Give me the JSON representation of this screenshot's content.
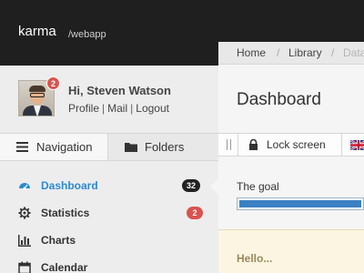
{
  "header": {
    "brand": "karma",
    "brand_sub": "/webapp"
  },
  "user": {
    "greeting": "Hi, Steven Watson",
    "notification_count": "2",
    "links": [
      "Profile",
      "Mail",
      "Logout"
    ]
  },
  "sidebar_tabs": [
    {
      "label": "Navigation",
      "icon": "menu-icon"
    },
    {
      "label": "Folders",
      "icon": "folder-icon"
    }
  ],
  "nav": [
    {
      "label": "Dashboard",
      "icon": "dashboard-icon",
      "badge": "32",
      "active": true
    },
    {
      "label": "Statistics",
      "icon": "gear-icon",
      "badge": "2"
    },
    {
      "label": "Charts",
      "icon": "bar-chart-icon"
    },
    {
      "label": "Calendar",
      "icon": "calendar-icon"
    }
  ],
  "breadcrumb": [
    "Home",
    "Library",
    "Data"
  ],
  "page": {
    "title": "Dashboard"
  },
  "toolbar": {
    "lock_label": "Lock screen",
    "language_icon": "uk-flag-icon"
  },
  "goal": {
    "label": "The goal",
    "progress_percent": 100
  },
  "hello": {
    "text": "Hello..."
  },
  "colors": {
    "accent": "#2a8bd2",
    "topbar": "#1f1f1f",
    "badge_red": "#d9534f",
    "badge_dark": "#222222",
    "progress": "#3b80c2",
    "hello_bg": "#fbf5e2"
  }
}
